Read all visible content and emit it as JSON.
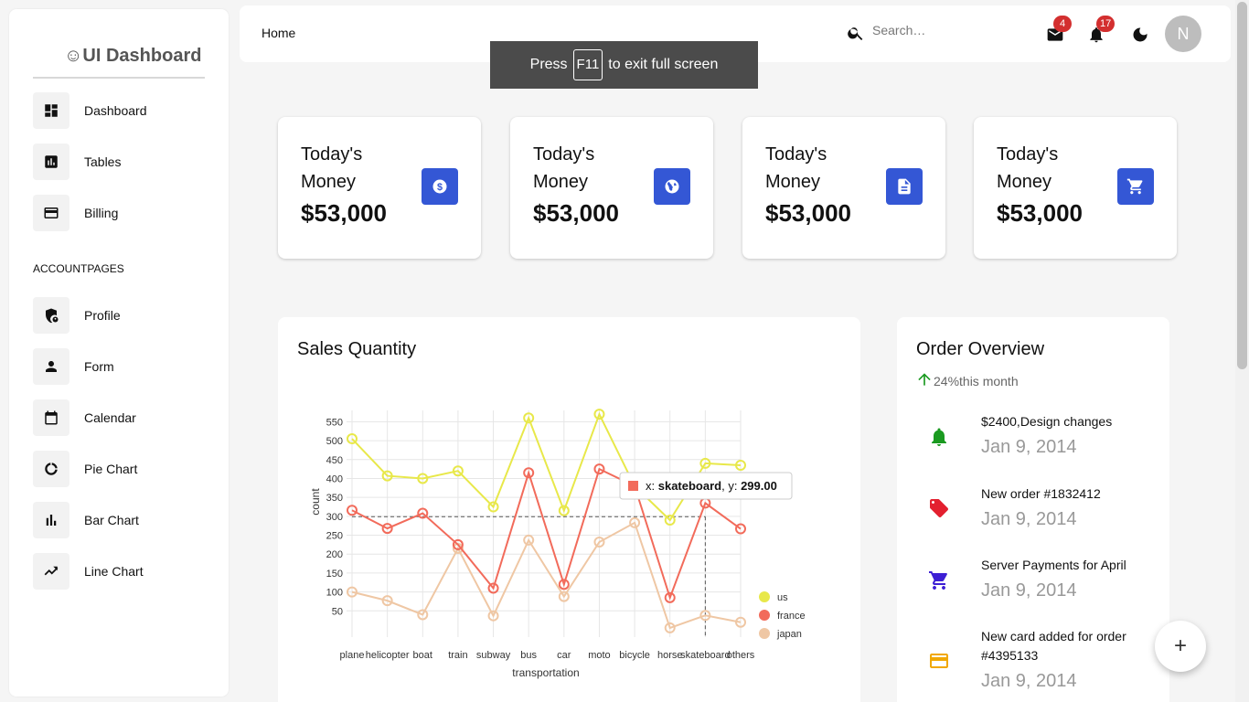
{
  "sidebar": {
    "brand": "☺UI Dashboard",
    "items": [
      {
        "label": "Dashboard",
        "icon": "dashboard-icon"
      },
      {
        "label": "Tables",
        "icon": "tables-icon"
      },
      {
        "label": "Billing",
        "icon": "credit-card-icon"
      }
    ],
    "section_label": "ACCOUNTPAGES",
    "account_items": [
      {
        "label": "Profile",
        "icon": "profile-shield-icon"
      },
      {
        "label": "Form",
        "icon": "person-icon"
      },
      {
        "label": "Calendar",
        "icon": "calendar-icon"
      },
      {
        "label": "Pie Chart",
        "icon": "donut-icon"
      },
      {
        "label": "Bar Chart",
        "icon": "bar-chart-icon"
      },
      {
        "label": "Line Chart",
        "icon": "line-chart-icon"
      }
    ]
  },
  "topbar": {
    "breadcrumb": "Home",
    "search_placeholder": "Search…",
    "mail_badge": "4",
    "notification_badge": "17",
    "avatar_initial": "N"
  },
  "fullscreen_toast": {
    "before": "Press",
    "key": "F11",
    "after": "to exit full screen"
  },
  "stats": [
    {
      "title": "Today's Money",
      "value": "$53,000",
      "icon": "dollar-icon"
    },
    {
      "title": "Today's Money",
      "value": "$53,000",
      "icon": "globe-icon"
    },
    {
      "title": "Today's Money",
      "value": "$53,000",
      "icon": "document-icon"
    },
    {
      "title": "Today's Money",
      "value": "$53,000",
      "icon": "cart-icon"
    }
  ],
  "colors": {
    "accent": "#3457d5",
    "us": "#e8e84a",
    "france": "#f26b5b",
    "japan": "#efc7a4"
  },
  "sales": {
    "title": "Sales Quantity"
  },
  "chart_data": {
    "type": "line",
    "xlabel": "transportation",
    "ylabel": "count",
    "ylim": [
      0,
      580
    ],
    "yticks": [
      50,
      100,
      150,
      200,
      250,
      300,
      350,
      400,
      450,
      500,
      550
    ],
    "grid": true,
    "legend_placement": "right",
    "categories": [
      "plane",
      "helicopter",
      "boat",
      "train",
      "subway",
      "bus",
      "car",
      "moto",
      "bicycle",
      "horse",
      "skateboard",
      "others"
    ],
    "series": [
      {
        "name": "us",
        "values": [
          505,
          407,
          400,
          420,
          325,
          560,
          315,
          570,
          380,
          290,
          440,
          435
        ]
      },
      {
        "name": "france",
        "values": [
          316,
          268,
          308,
          225,
          110,
          415,
          120,
          425,
          380,
          85,
          335,
          267
        ]
      },
      {
        "name": "japan",
        "values": [
          100,
          77,
          40,
          215,
          37,
          237,
          88,
          232,
          283,
          5,
          38,
          20
        ]
      }
    ],
    "tooltip": {
      "x_label": "x:",
      "x_value": "skateboard",
      "y_label": "y:",
      "y_value": "299.00"
    }
  },
  "orders": {
    "title": "Order Overview",
    "trend": "24%this month",
    "items": [
      {
        "text": "$2400,Design changes",
        "date": "Jan 9, 2014",
        "icon": "bell-icon",
        "color": "#1a9a20"
      },
      {
        "text": "New order #1832412",
        "date": "Jan 9, 2014",
        "icon": "tag-icon",
        "color": "#e3202f"
      },
      {
        "text": "Server Payments for April",
        "date": "Jan 9, 2014",
        "icon": "cart-icon",
        "color": "#3d1fd4"
      },
      {
        "text": "New card added for order #4395133",
        "date": "Jan 9, 2014",
        "icon": "credit-card-icon",
        "color": "#f1a800"
      }
    ]
  },
  "fab_label": "+"
}
